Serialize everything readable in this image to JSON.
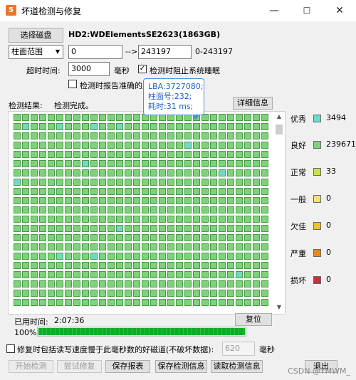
{
  "window": {
    "title": "坏道检测与修复",
    "app_icon_text": "5",
    "minimize": "—",
    "maximize": "☐",
    "close": "✕"
  },
  "disk": {
    "select_button": "选择磁盘",
    "name": "HD2:WDElementsSE2623(1863GB)"
  },
  "range": {
    "mode": "柱面范围",
    "start": "0",
    "arrow": "-->",
    "end": "243197",
    "hint": "0-243197"
  },
  "timeout": {
    "label": "超时时间:",
    "value": "3000",
    "unit": "毫秒"
  },
  "options": {
    "prevent_sleep": "检测时阻止系统睡眠",
    "prevent_sleep_checked": true,
    "report_accurate": "检测时报告准确的扇",
    "report_accurate_checked": false
  },
  "tooltip": {
    "lba": "LBA:3727080;",
    "cylinder": "柱面号:232;",
    "time": "耗时:31 ms;"
  },
  "results": {
    "label": "检测结果:",
    "status": "检测完成。",
    "details_button": "详细信息"
  },
  "legend": [
    {
      "name": "优秀",
      "color": "#6fd8c8",
      "count": "3494"
    },
    {
      "name": "良好",
      "color": "#7ed37a",
      "count": "239671"
    },
    {
      "name": "正常",
      "color": "#c6e24b",
      "count": "33"
    },
    {
      "name": "一般",
      "color": "#f5df7a",
      "count": "0"
    },
    {
      "name": "欠佳",
      "color": "#f0c030",
      "count": "0"
    },
    {
      "name": "严重",
      "color": "#e88a1a",
      "count": "0"
    },
    {
      "name": "损坏",
      "color": "#c8313a",
      "count": "0"
    }
  ],
  "grid": {
    "good_color": "#7ed37a",
    "excellent_color": "#6fd8c8"
  },
  "elapsed": {
    "label": "已用时间:",
    "value": "2:07:36",
    "reset_button": "复位"
  },
  "progress": {
    "percent_text": "100%",
    "value": 100
  },
  "repair": {
    "checkbox_label": "修复时包括读写速度慢于此毫秒数的好磁道(不破坏数据):",
    "checked": false,
    "value": "620",
    "unit": "毫秒"
  },
  "buttons": {
    "start": "开始检测",
    "try_repair": "尝试修复",
    "save_report": "保存报表",
    "save_result": "保存检测信息",
    "load_result": "读取检测信息",
    "exit": "退出"
  },
  "watermark": "CSDN @YMWM_"
}
